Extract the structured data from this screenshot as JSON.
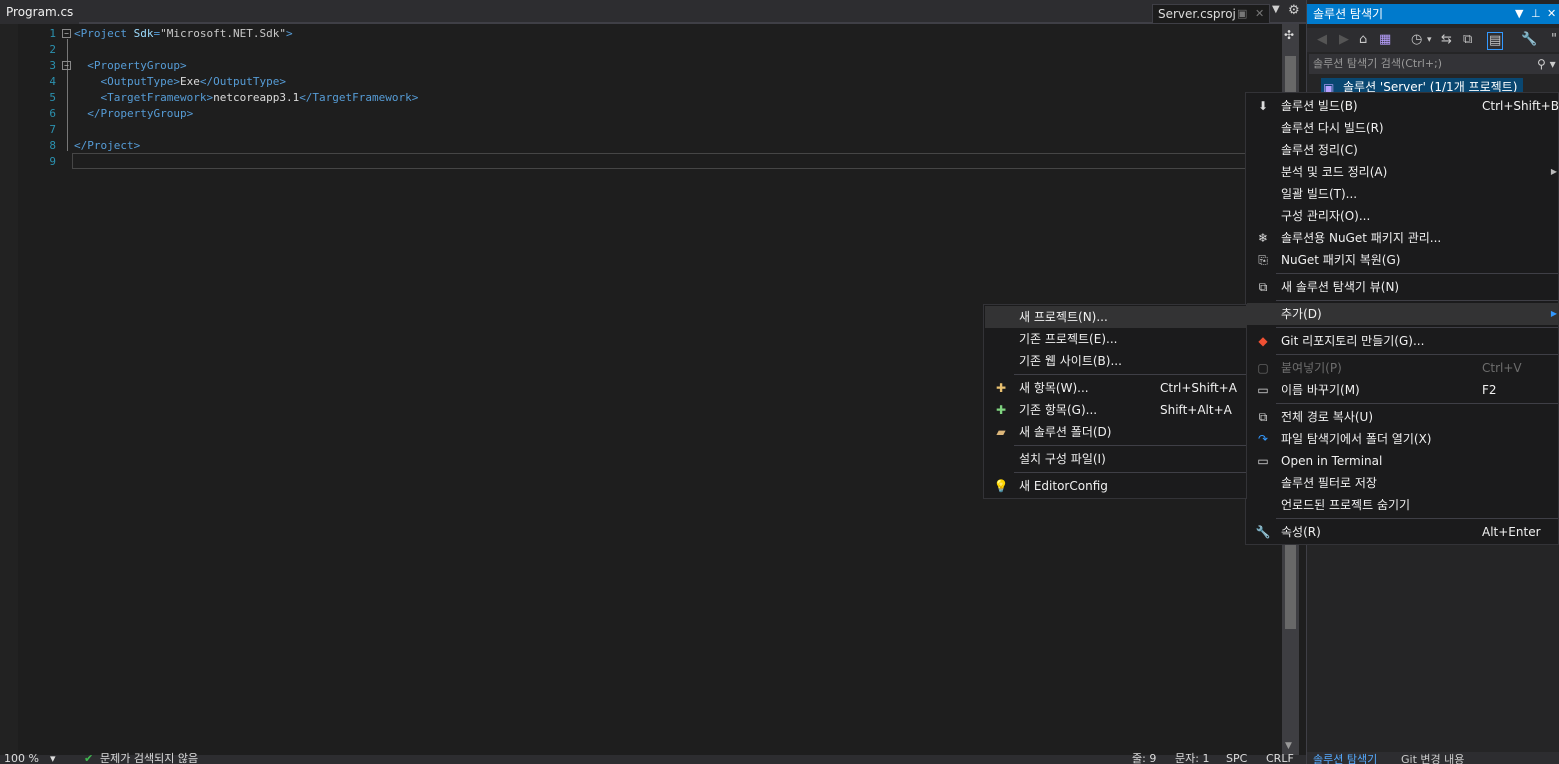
{
  "tabs": {
    "active": "Program.cs",
    "preview": "Server.csproj"
  },
  "editor": {
    "line_numbers": [
      "1",
      "2",
      "3",
      "4",
      "5",
      "6",
      "7",
      "8",
      "9"
    ],
    "lines": [
      {
        "open": "<",
        "tag": "Project",
        "sp": " ",
        "attr": "Sdk",
        "eq": "=",
        "val": "\"Microsoft.NET.Sdk\"",
        "close": ">"
      },
      {},
      {
        "indent": "  ",
        "open": "<",
        "tag": "PropertyGroup",
        "close": ">"
      },
      {
        "indent": "    ",
        "open": "<",
        "tag": "OutputType",
        "close": ">",
        "text": "Exe",
        "end": "</OutputType>"
      },
      {
        "indent": "    ",
        "open": "<",
        "tag": "TargetFramework",
        "close": ">",
        "text": "netcoreapp3.1",
        "end": "</TargetFramework>"
      },
      {
        "indent": "  ",
        "open": "</",
        "tag": "PropertyGroup",
        "close": ">"
      },
      {},
      {
        "open": "</",
        "tag": "Project",
        "close": ">"
      },
      {}
    ]
  },
  "statusbar": {
    "zoom": "100 %",
    "issues": "문제가 검색되지 않음",
    "line": "줄: 9",
    "col": "문자: 1",
    "spc": "SPC",
    "eol": "CRLF"
  },
  "solution_explorer": {
    "title": "솔루션 탐색기",
    "search_placeholder": "솔루션 탐색기 검색(Ctrl+;)",
    "root_item": "솔루션 'Server' (1/1개 프로젝트)",
    "bottom_tabs": [
      "솔루션 탐색기",
      "Git 변경 내용"
    ]
  },
  "context_menu": {
    "items": [
      {
        "label": "솔루션 빌드(B)",
        "shortcut": "Ctrl+Shift+B",
        "icon": "build-icon"
      },
      {
        "label": "솔루션 다시 빌드(R)"
      },
      {
        "label": "솔루션 정리(C)"
      },
      {
        "label": "분석 및 코드 정리(A)",
        "submenu": true
      },
      {
        "label": "일괄 빌드(T)..."
      },
      {
        "label": "구성 관리자(O)..."
      },
      {
        "label": "솔루션용 NuGet 패키지 관리...",
        "icon": "nuget-icon"
      },
      {
        "label": "NuGet 패키지 복원(G)",
        "icon": "restore-icon"
      },
      {
        "label": "새 솔루션 탐색기 뷰(N)",
        "icon": "new-view-icon"
      },
      {
        "label": "추가(D)",
        "submenu": true,
        "highlighted": true
      },
      {
        "label": "Git 리포지토리 만들기(G)...",
        "icon": "git-icon"
      },
      {
        "label": "붙여넣기(P)",
        "shortcut": "Ctrl+V",
        "disabled": true,
        "icon": "paste-icon"
      },
      {
        "label": "이름 바꾸기(M)",
        "shortcut": "F2",
        "icon": "rename-icon"
      },
      {
        "label": "전체 경로 복사(U)",
        "icon": "copy-icon"
      },
      {
        "label": "파일 탐색기에서 폴더 열기(X)",
        "icon": "open-folder-icon"
      },
      {
        "label": "Open in Terminal",
        "icon": "terminal-icon"
      },
      {
        "label": "솔루션 필터로 저장"
      },
      {
        "label": "언로드된 프로젝트 숨기기"
      },
      {
        "label": "속성(R)",
        "shortcut": "Alt+Enter",
        "icon": "wrench-icon"
      }
    ]
  },
  "submenu": {
    "items": [
      {
        "label": "새 프로젝트(N)...",
        "highlighted": true
      },
      {
        "label": "기존 프로젝트(E)..."
      },
      {
        "label": "기존 웹 사이트(B)..."
      },
      {
        "label": "새 항목(W)...",
        "shortcut": "Ctrl+Shift+A",
        "icon": "new-item-icon"
      },
      {
        "label": "기존 항목(G)...",
        "shortcut": "Shift+Alt+A",
        "icon": "existing-item-icon"
      },
      {
        "label": "새 솔루션 폴더(D)",
        "icon": "new-folder-icon"
      },
      {
        "label": "설치 구성 파일(I)"
      },
      {
        "label": "새 EditorConfig",
        "icon": "editorconfig-icon"
      }
    ]
  }
}
